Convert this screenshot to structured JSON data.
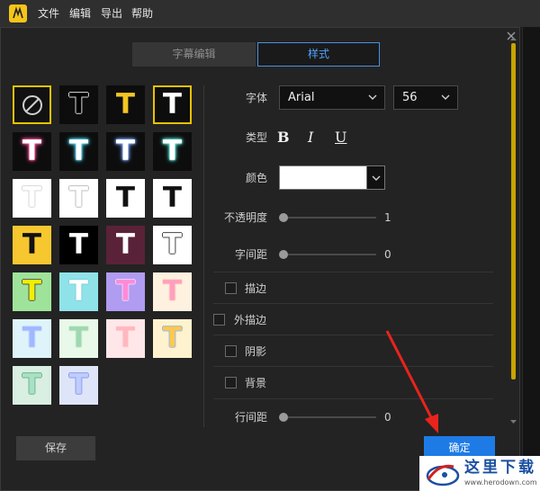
{
  "menu": {
    "items": [
      {
        "label": "文件"
      },
      {
        "label": "编辑"
      },
      {
        "label": "导出"
      },
      {
        "label": "帮助"
      }
    ]
  },
  "tabs": {
    "subtitle_edit": "字幕编辑",
    "style": "样式",
    "active": "style"
  },
  "presets": [
    {
      "glyph": "",
      "kind": "none",
      "selected": true
    },
    {
      "glyph": "T",
      "bg": "#0d0d0d",
      "fg": "#000000",
      "stroke": "#d9d9d9"
    },
    {
      "glyph": "T",
      "bg": "#0d0d0d",
      "fg": "#f3c623"
    },
    {
      "glyph": "T",
      "bg": "#0d0d0d",
      "fg": "#ffffff",
      "selected": true
    },
    {
      "glyph": "T",
      "bg": "#0d0d0d",
      "fg": "#ffffff",
      "glow": "#ff4fa0"
    },
    {
      "glyph": "T",
      "bg": "#0d0d0d",
      "fg": "#ffffff",
      "glow": "#52e0ff"
    },
    {
      "glyph": "T",
      "bg": "#0d0d0d",
      "fg": "#ffffff",
      "glow": "#7aa8ff"
    },
    {
      "glyph": "T",
      "bg": "#0d0d0d",
      "fg": "#ffffff",
      "glow": "#59e8d8"
    },
    {
      "glyph": "T",
      "bg": "#ffffff",
      "fg": "#ffffff",
      "stroke": "#d8d8d8"
    },
    {
      "glyph": "T",
      "bg": "#ffffff",
      "fg": "#ffffff",
      "stroke": "#bfbfbf"
    },
    {
      "glyph": "T",
      "bg": "#ffffff",
      "fg": "#111111"
    },
    {
      "glyph": "T",
      "bg": "#ffffff",
      "fg": "#111111"
    },
    {
      "glyph": "T",
      "bg": "#f7c72f",
      "fg": "#111111"
    },
    {
      "glyph": "T",
      "bg": "#000000",
      "fg": "#ffffff"
    },
    {
      "glyph": "T",
      "bg": "#5a2238",
      "fg": "#ffffff"
    },
    {
      "glyph": "T",
      "bg": "#ffffff",
      "fg": "#ffffff",
      "stroke": "#444444"
    },
    {
      "glyph": "T",
      "bg": "#9fe39b",
      "fg": "#f0f000",
      "stroke": "#555555"
    },
    {
      "glyph": "T",
      "bg": "#8fe3e8",
      "fg": "#ffffff",
      "stroke": "#7ad0e0"
    },
    {
      "glyph": "T",
      "bg": "#b09cf0",
      "fg": "#ff8ad6",
      "stroke": "#e9d2ff"
    },
    {
      "glyph": "T",
      "bg": "#fff1e0",
      "fg": "#ff9fc0",
      "stroke": "#ffd9c0"
    },
    {
      "glyph": "T",
      "bg": "#dff3fb",
      "fg": "#9fb8ff",
      "stroke": "#c9dcff"
    },
    {
      "glyph": "T",
      "bg": "#e9f9e9",
      "fg": "#9fd8b0",
      "stroke": "#d0f0d8"
    },
    {
      "glyph": "T",
      "bg": "#ffe6e8",
      "fg": "#ffb8c0",
      "stroke": "#ffe0e0"
    },
    {
      "glyph": "T",
      "bg": "#fff3cf",
      "fg": "#ffc94a",
      "stroke": "#98b8f0"
    },
    {
      "glyph": "T",
      "bg": "#d8efe2",
      "fg": "#a8e2c4",
      "stroke": "#78b090"
    },
    {
      "glyph": "T",
      "bg": "#dfe5f8",
      "fg": "#c0ccff",
      "stroke": "#8aa0e8"
    }
  ],
  "form": {
    "font_label": "字体",
    "font_value": "Arial",
    "size_value": "56",
    "type_label": "类型",
    "bold": "B",
    "italic": "I",
    "underline": "U",
    "color_label": "颜色",
    "color_value": "#ffffff",
    "opacity_label": "不透明度",
    "opacity_value": "1",
    "spacing_label": "字间距",
    "spacing_value": "0",
    "stroke_label": "描边",
    "outer_stroke_label": "外描边",
    "shadow_label": "阴影",
    "background_label": "背景",
    "line_spacing_label": "行间距",
    "line_spacing_value": "0"
  },
  "footer": {
    "save": "保存",
    "confirm": "确定"
  },
  "watermark": {
    "text": "这里下载",
    "url": "www.herodown.com"
  }
}
